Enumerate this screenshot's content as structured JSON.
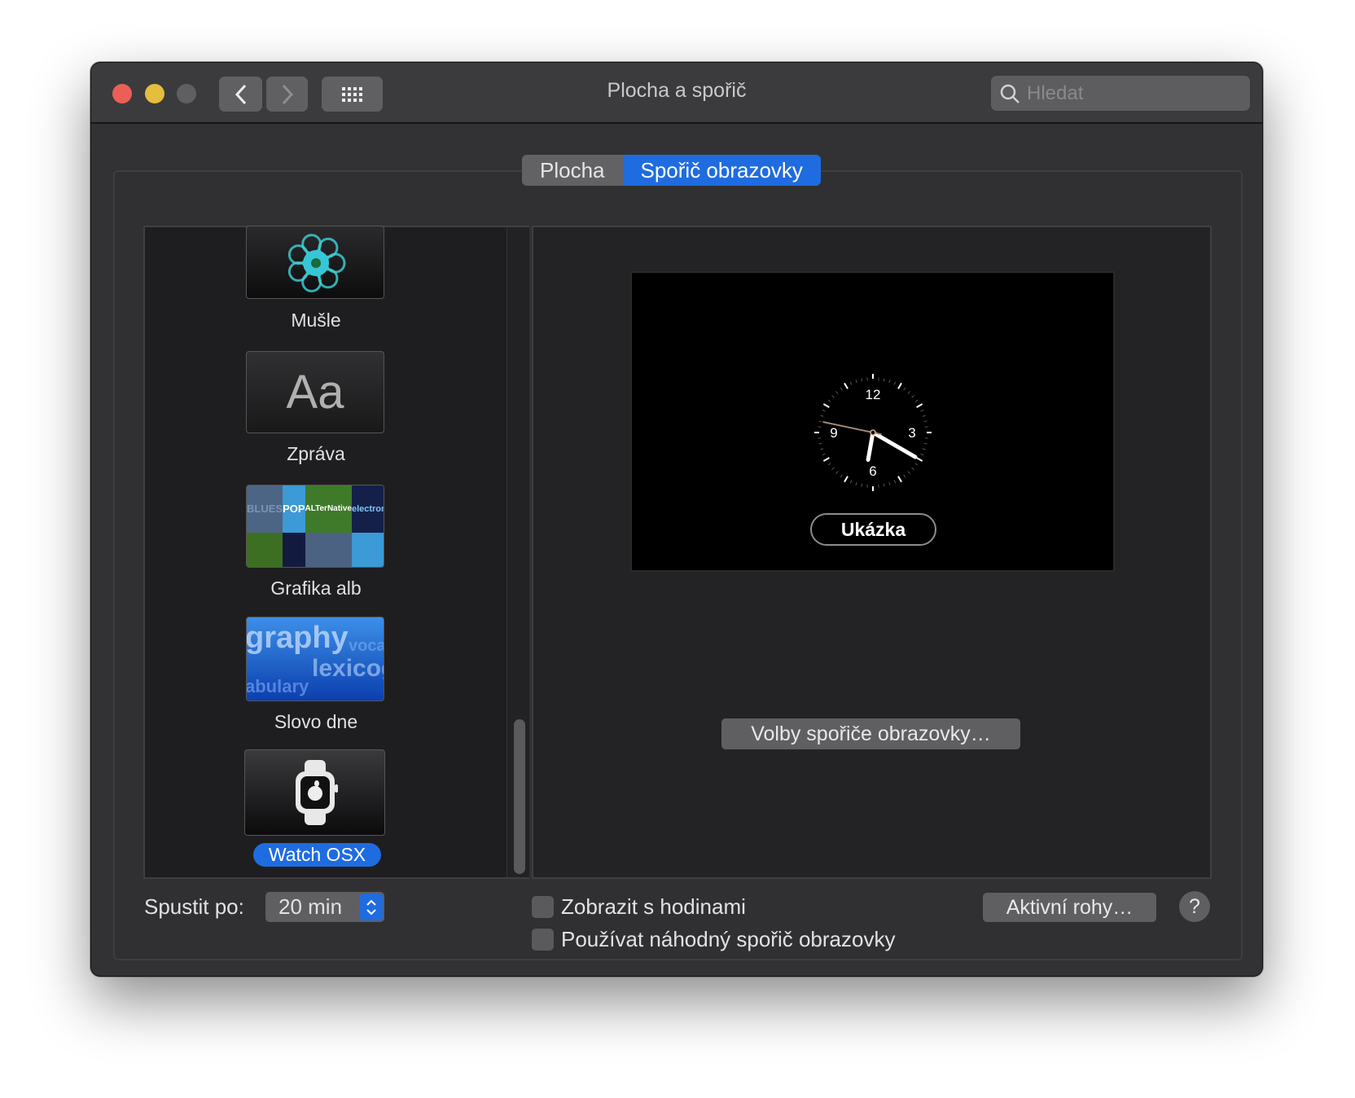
{
  "window": {
    "title": "Plocha a spořič"
  },
  "toolbar": {
    "search_placeholder": "Hledat"
  },
  "tabs": [
    {
      "label": "Plocha",
      "selected": false
    },
    {
      "label": "Spořič obrazovky",
      "selected": true
    }
  ],
  "savers": [
    {
      "label": "Mušle"
    },
    {
      "label": "Zpráva",
      "thumb_text": "Aa"
    },
    {
      "label": "Grafika alb",
      "thumb_words": [
        "BLUES",
        "POP",
        "ALTerNative",
        "electronic"
      ]
    },
    {
      "label": "Slovo dne",
      "thumb_words": [
        "graphy",
        "voca",
        "lexicog",
        "abulary"
      ]
    },
    {
      "label": "Watch OSX",
      "selected": true
    }
  ],
  "preview": {
    "clock_numbers": [
      "12",
      "3",
      "6",
      "9"
    ],
    "clock_time": {
      "hour": 6,
      "minute": 20,
      "second": 47
    },
    "preview_button": "Ukázka",
    "options_button": "Volby spořiče obrazovky…"
  },
  "bottom": {
    "start_after_label": "Spustit po:",
    "start_after_value": "20 min",
    "show_clock_label": "Zobrazit s hodinami",
    "show_clock_checked": false,
    "random_label": "Používat náhodný spořič obrazovky",
    "random_checked": false,
    "hot_corners": "Aktivní rohy…",
    "help": "?"
  },
  "colors": {
    "accent": "#1f6ce0",
    "close": "#ec5f57",
    "minimize": "#e4be3e"
  }
}
